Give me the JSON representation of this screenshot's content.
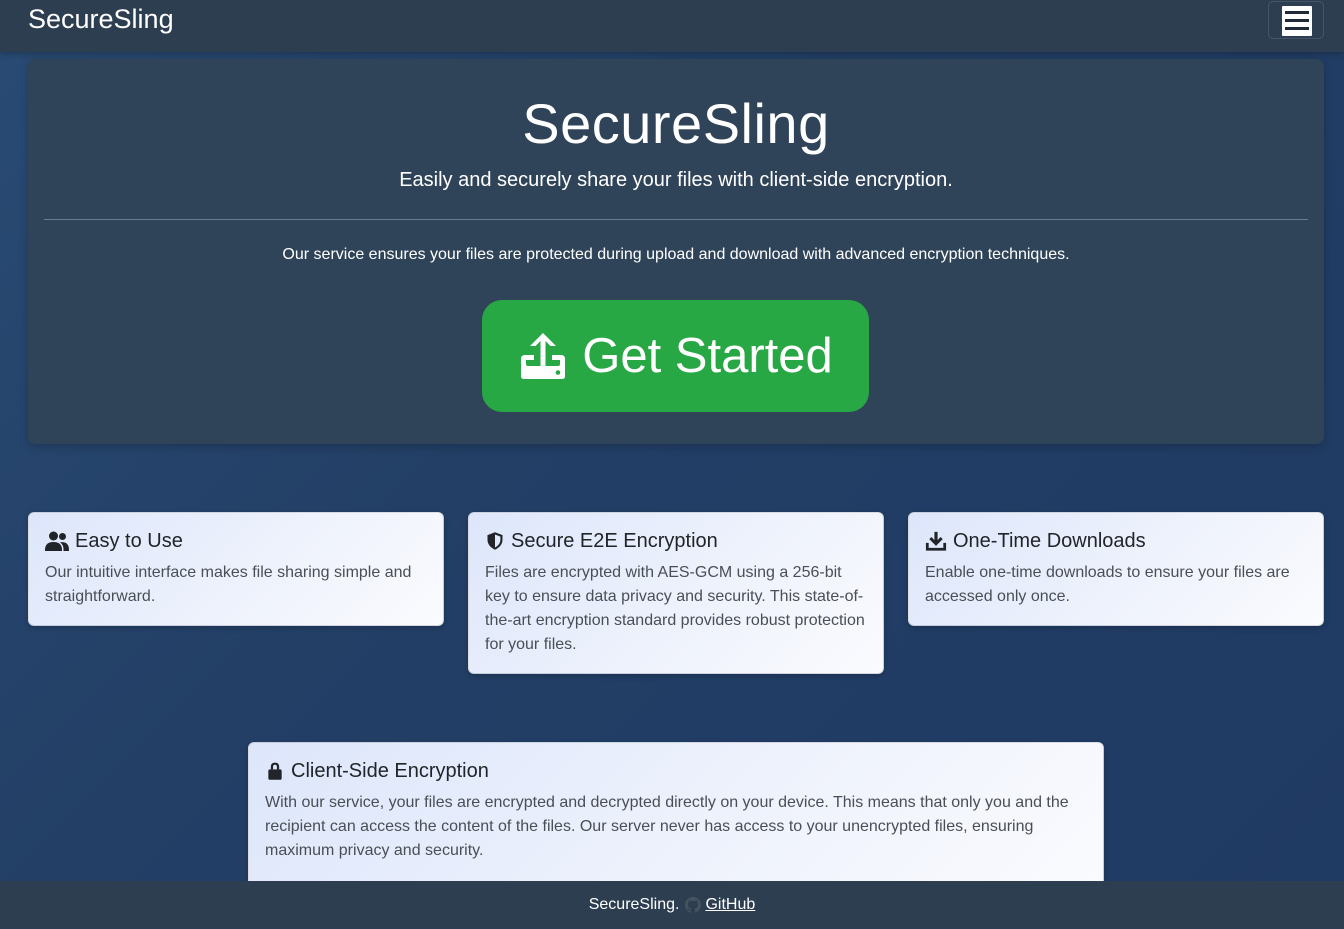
{
  "navbar": {
    "brand": "SecureSling",
    "menu_icon": "hamburger-menu-icon"
  },
  "hero": {
    "title": "SecureSling",
    "lead": "Easily and securely share your files with client-side encryption.",
    "description": "Our service ensures your files are protected during upload and download with advanced encryption techniques.",
    "cta_label": "Get Started",
    "cta_icon": "upload-icon",
    "cta_color": "#28a745"
  },
  "features": [
    {
      "icon": "users-icon",
      "title": "Easy to Use",
      "text": "Our intuitive interface makes file sharing simple and straightforward."
    },
    {
      "icon": "shield-icon",
      "title": "Secure E2E Encryption",
      "text": "Files are encrypted with AES-GCM using a 256-bit key to ensure data privacy and security. This state-of-the-art encryption standard provides robust protection for your files."
    },
    {
      "icon": "download-icon",
      "title": "One-Time Downloads",
      "text": "Enable one-time downloads to ensure your files are accessed only once."
    },
    {
      "icon": "lock-icon",
      "title": "Client-Side Encryption",
      "text": "With our service, your files are encrypted and decrypted directly on your device. This means that only you and the recipient can access the content of the files. Our server never has access to your unencrypted files, ensuring maximum privacy and security."
    }
  ],
  "footer": {
    "text": "SecureSling.",
    "link_label": "GitHub",
    "link_icon": "github-icon"
  }
}
